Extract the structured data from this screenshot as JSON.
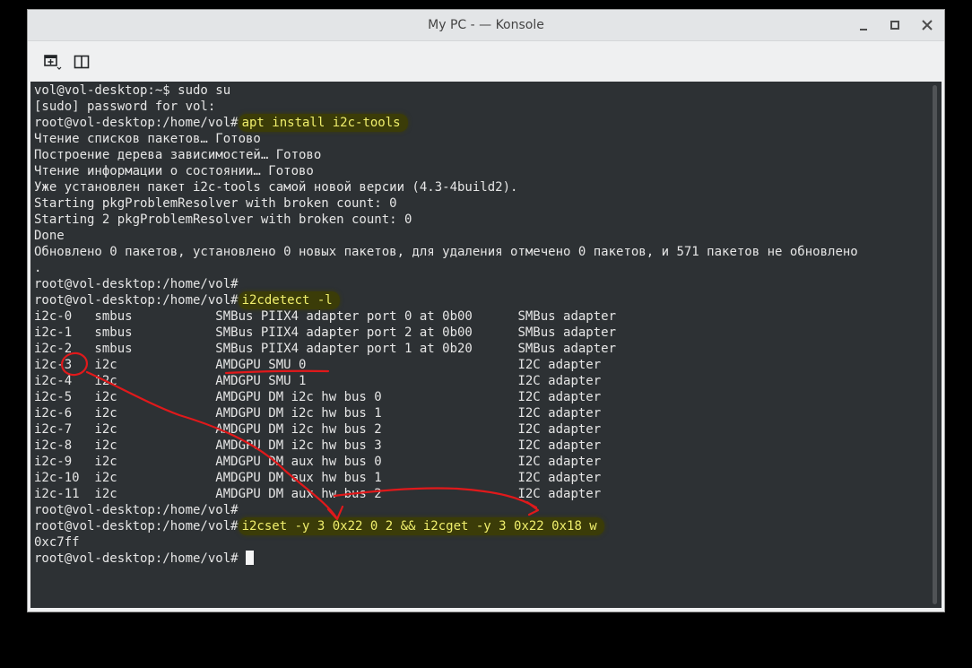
{
  "window": {
    "title": "My PC - — Konsole",
    "minimize_glyph": "−",
    "maximize_glyph": "◇",
    "close_glyph": "×"
  },
  "toolbar": {
    "new_tab_icon": "new-tab-icon",
    "split_view_icon": "split-view-icon"
  },
  "terminal": {
    "lines": [
      {
        "prompt": "",
        "text": "vol@vol-desktop:~$ sudo su",
        "highlight": false
      },
      {
        "prompt": "",
        "text": "[sudo] password for vol:",
        "highlight": false
      },
      {
        "prompt": "root@vol-desktop:/home/vol#",
        "text": "apt install i2c-tools",
        "highlight": true
      },
      {
        "prompt": "",
        "text": "Чтение списков пакетов… Готово",
        "highlight": false
      },
      {
        "prompt": "",
        "text": "Построение дерева зависимостей… Готово",
        "highlight": false
      },
      {
        "prompt": "",
        "text": "Чтение информации о состоянии… Готово",
        "highlight": false
      },
      {
        "prompt": "",
        "text": "Уже установлен пакет i2c-tools самой новой версии (4.3-4build2).",
        "highlight": false
      },
      {
        "prompt": "",
        "text": "Starting pkgProblemResolver with broken count: 0",
        "highlight": false
      },
      {
        "prompt": "",
        "text": "Starting 2 pkgProblemResolver with broken count: 0",
        "highlight": false
      },
      {
        "prompt": "",
        "text": "Done",
        "highlight": false
      },
      {
        "prompt": "",
        "text": "Обновлено 0 пакетов, установлено 0 новых пакетов, для удаления отмечено 0 пакетов, и 571 пакетов не обновлено",
        "highlight": false
      },
      {
        "prompt": "",
        "text": ".",
        "highlight": false
      },
      {
        "prompt": "",
        "text": "root@vol-desktop:/home/vol#",
        "highlight": false
      },
      {
        "prompt": "root@vol-desktop:/home/vol#",
        "text": "i2cdetect -l",
        "highlight": true
      },
      {
        "prompt": "",
        "text": "i2c-0   smbus           SMBus PIIX4 adapter port 0 at 0b00      SMBus adapter",
        "highlight": false
      },
      {
        "prompt": "",
        "text": "i2c-1   smbus           SMBus PIIX4 adapter port 2 at 0b00      SMBus adapter",
        "highlight": false
      },
      {
        "prompt": "",
        "text": "i2c-2   smbus           SMBus PIIX4 adapter port 1 at 0b20      SMBus adapter",
        "highlight": false
      },
      {
        "prompt": "",
        "text": "i2c-3   i2c             AMDGPU SMU 0                            I2C adapter",
        "highlight": false
      },
      {
        "prompt": "",
        "text": "i2c-4   i2c             AMDGPU SMU 1                            I2C adapter",
        "highlight": false
      },
      {
        "prompt": "",
        "text": "i2c-5   i2c             AMDGPU DM i2c hw bus 0                  I2C adapter",
        "highlight": false
      },
      {
        "prompt": "",
        "text": "i2c-6   i2c             AMDGPU DM i2c hw bus 1                  I2C adapter",
        "highlight": false
      },
      {
        "prompt": "",
        "text": "i2c-7   i2c             AMDGPU DM i2c hw bus 2                  I2C adapter",
        "highlight": false
      },
      {
        "prompt": "",
        "text": "i2c-8   i2c             AMDGPU DM i2c hw bus 3                  I2C adapter",
        "highlight": false
      },
      {
        "prompt": "",
        "text": "i2c-9   i2c             AMDGPU DM aux hw bus 0                  I2C adapter",
        "highlight": false
      },
      {
        "prompt": "",
        "text": "i2c-10  i2c             AMDGPU DM aux hw bus 1                  I2C adapter",
        "highlight": false
      },
      {
        "prompt": "",
        "text": "i2c-11  i2c             AMDGPU DM aux hw bus 2                  I2C adapter",
        "highlight": false
      },
      {
        "prompt": "",
        "text": "root@vol-desktop:/home/vol#",
        "highlight": false
      },
      {
        "prompt": "root@vol-desktop:/home/vol#",
        "text": "i2cset -y 3 0x22 0 2 && i2cget -y 3 0x22 0x18 w",
        "highlight": true
      },
      {
        "prompt": "",
        "text": "0xc7ff",
        "highlight": false
      },
      {
        "prompt": "root@vol-desktop:/home/vol#",
        "text": "",
        "highlight": false,
        "cursor": true
      }
    ]
  },
  "annotations": {
    "color": "#e0191b"
  },
  "colors": {
    "terminal_bg": "#2d3134",
    "terminal_fg": "#e6e6e6",
    "highlight_bg": "#3b3c08",
    "highlight_fg": "#f0ef6c"
  }
}
